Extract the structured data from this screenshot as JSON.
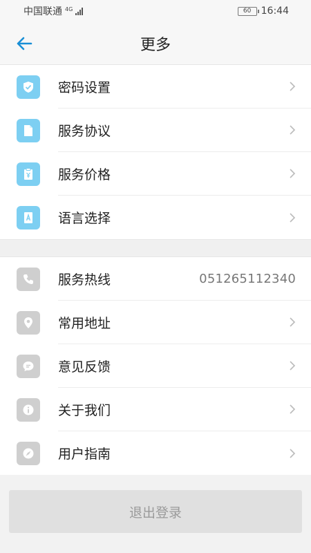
{
  "status_bar": {
    "carrier": "中国联通",
    "network": "4G",
    "battery": "60",
    "time": "16:44"
  },
  "header": {
    "title": "更多",
    "back_icon": "arrow-left-icon"
  },
  "group1": {
    "items": [
      {
        "label": "密码设置",
        "icon": "shield-check-icon"
      },
      {
        "label": "服务协议",
        "icon": "document-icon"
      },
      {
        "label": "服务价格",
        "icon": "price-tag-icon"
      },
      {
        "label": "语言选择",
        "icon": "language-book-icon"
      }
    ]
  },
  "group2": {
    "items": [
      {
        "label": "服务热线",
        "icon": "phone-icon",
        "value": "051265112340"
      },
      {
        "label": "常用地址",
        "icon": "location-pin-icon"
      },
      {
        "label": "意见反馈",
        "icon": "chat-bubble-icon"
      },
      {
        "label": "关于我们",
        "icon": "info-icon"
      },
      {
        "label": "用户指南",
        "icon": "compass-icon"
      }
    ]
  },
  "logout_label": "退出登录",
  "colors": {
    "accent": "#1a8fd6",
    "icon_blue": "#7dcff2",
    "icon_gray": "#cfcfcf",
    "logout_bg": "#e0e0e0"
  }
}
